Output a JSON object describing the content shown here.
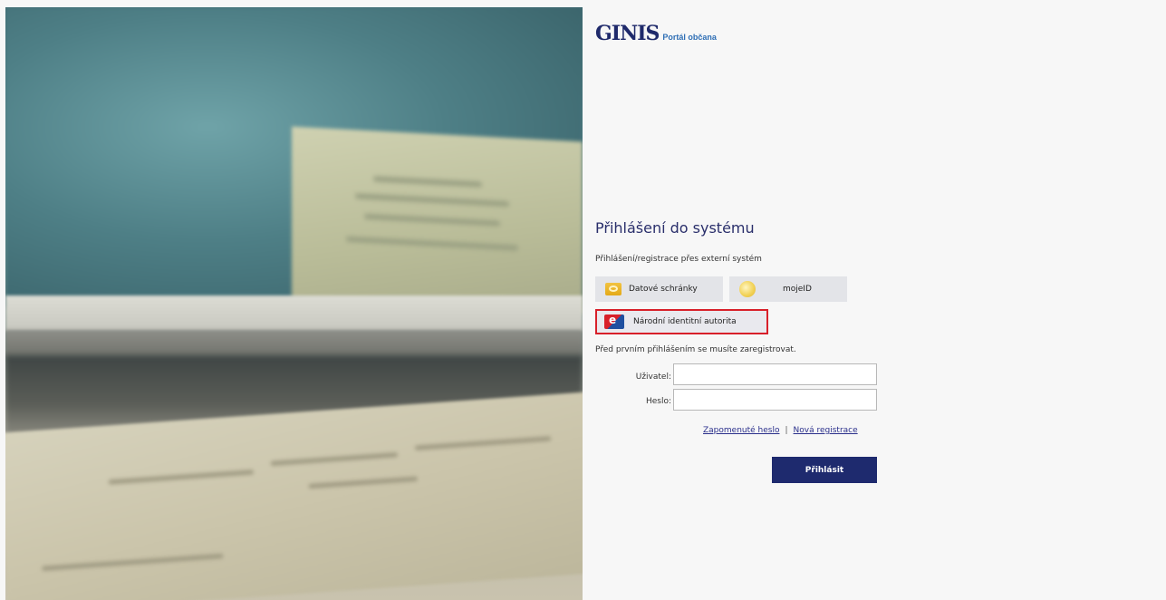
{
  "header": {
    "logo_text": "GINIS",
    "logo_subtitle": "Portál občana"
  },
  "login": {
    "title": "Přihlášení do systému",
    "external_label": "Přihlášení/registrace přes externí systém",
    "external_buttons": [
      {
        "label": "Datové schránky",
        "icon": "datove-schranky-icon"
      },
      {
        "label": "mojeID",
        "icon": "mojeid-icon"
      },
      {
        "label": "Národní identitní autorita",
        "icon": "nia-icon"
      }
    ],
    "registration_note": "Před prvním přihlášením se musíte zaregistrovat.",
    "user_label": "Uživatel:",
    "user_value": "",
    "password_label": "Heslo:",
    "password_value": "",
    "forgot_password_link": "Zapomenuté heslo",
    "link_separator": "|",
    "new_registration_link": "Nová registrace",
    "submit_label": "Přihlásit"
  },
  "colors": {
    "accent_dark_blue": "#1e2a6e",
    "highlight_red": "#d8202a",
    "panel_background": "#f7f7f7"
  }
}
